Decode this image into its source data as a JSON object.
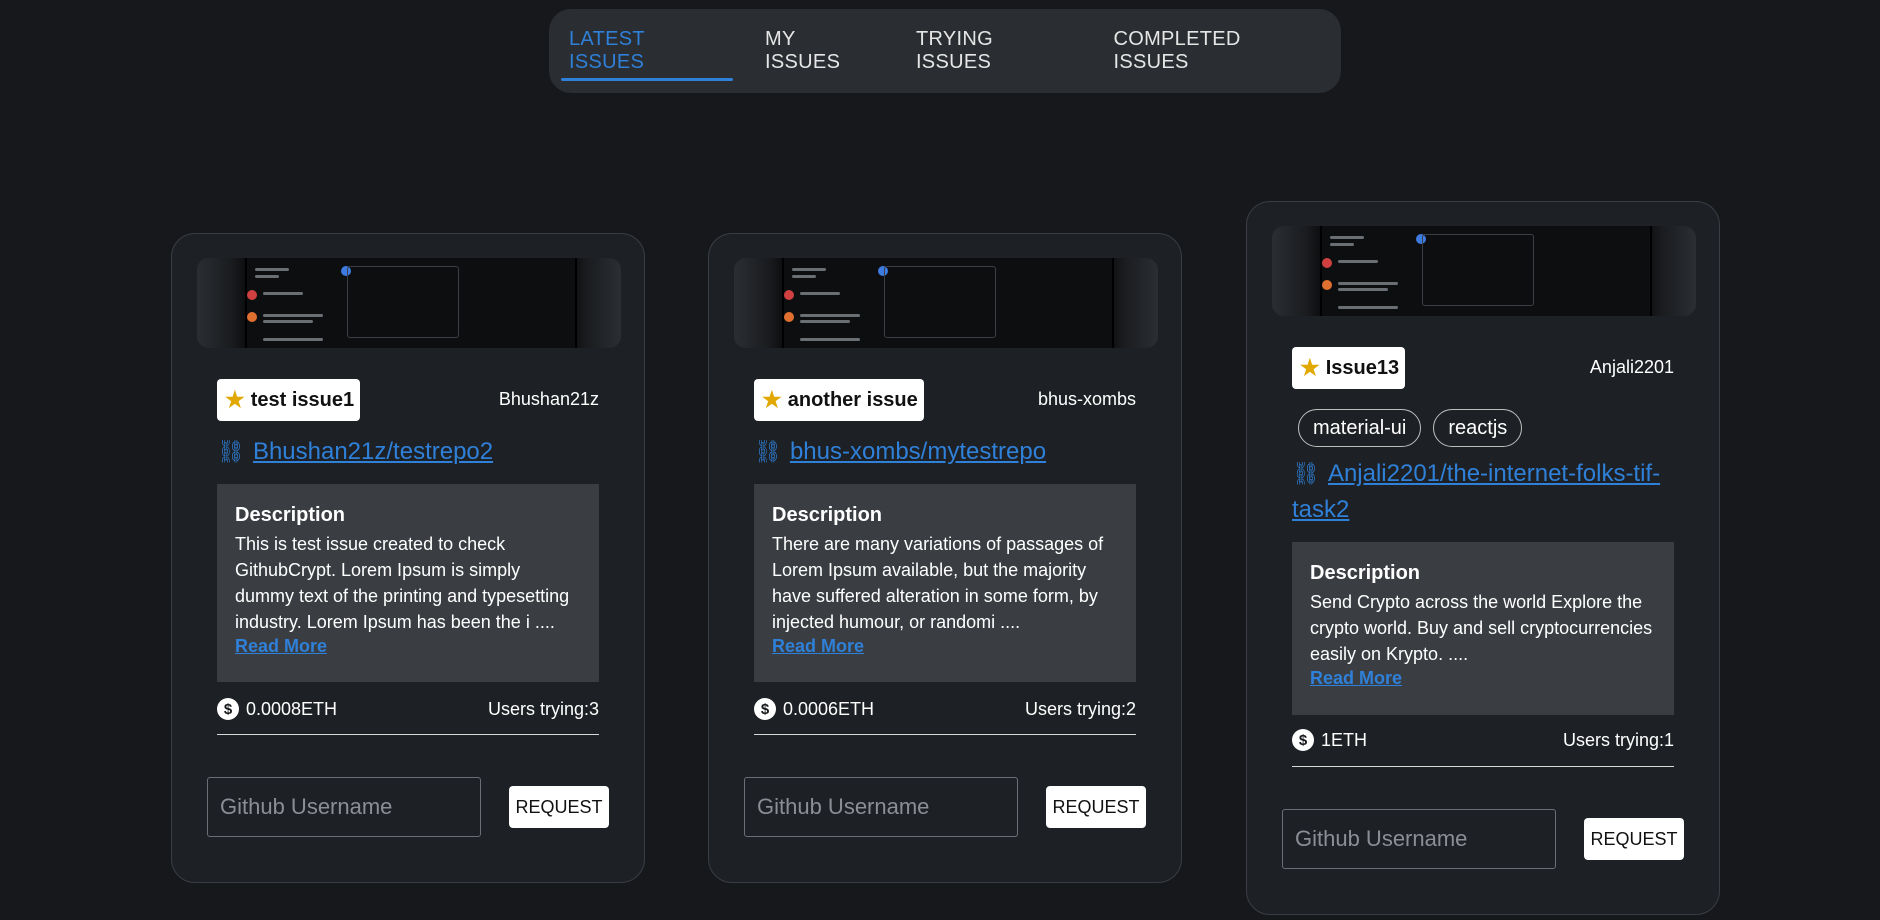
{
  "tabs": [
    {
      "label": "LATEST ISSUES",
      "active": true
    },
    {
      "label": "MY ISSUES",
      "active": false
    },
    {
      "label": "TRYING ISSUES",
      "active": false
    },
    {
      "label": "COMPLETED ISSUES",
      "active": false
    }
  ],
  "cards": [
    {
      "title": "test issue1",
      "owner": "Bhushan21z",
      "repo": "Bhushan21z/testrepo2",
      "tags": [],
      "description_heading": "Description",
      "description": "This is test issue created to check GithubCrypt. Lorem Ipsum is simply dummy text of the printing and typesetting industry. Lorem Ipsum has been the i ....",
      "read_more": "Read More",
      "price": "0.0008ETH",
      "users_trying": "Users trying:3",
      "input_placeholder": "Github Username",
      "button_label": "REQUEST"
    },
    {
      "title": "another issue",
      "owner": "bhus-xombs",
      "repo": "bhus-xombs/mytestrepo",
      "tags": [],
      "description_heading": "Description",
      "description": "There are many variations of passages of Lorem Ipsum available, but the majority have suffered alteration in some form, by injected humour, or randomi ....",
      "read_more": "Read More",
      "price": "0.0006ETH",
      "users_trying": "Users trying:2",
      "input_placeholder": "Github Username",
      "button_label": "REQUEST"
    },
    {
      "title": "Issue13",
      "owner": "Anjali2201",
      "repo": "Anjali2201/the-internet-folks-tif-task2",
      "tags": [
        "material-ui",
        "reactjs"
      ],
      "description_heading": "Description",
      "description": "Send Crypto across the world Explore the crypto world. Buy and sell cryptocurrencies easily on Krypto. ....",
      "read_more": "Read More",
      "price": "1ETH",
      "users_trying": "Users trying:1",
      "input_placeholder": "Github Username",
      "button_label": "REQUEST"
    }
  ],
  "icons": {
    "star": "star-icon",
    "link": "link-icon",
    "coin": "dollar-coin-icon"
  },
  "colors": {
    "accent": "#2f80d8",
    "star": "#e0a800",
    "background": "#16181b",
    "card": "#1d2024"
  }
}
